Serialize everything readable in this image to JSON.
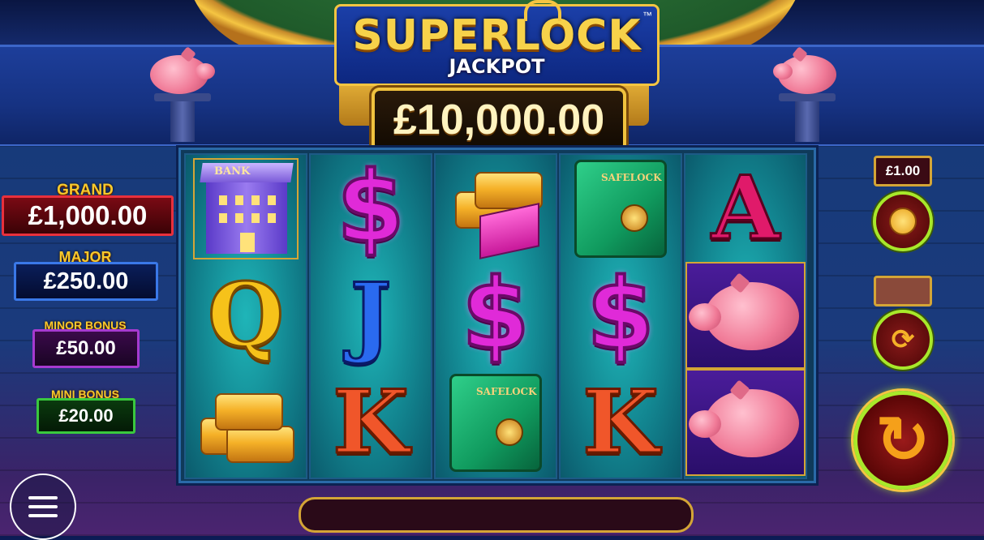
{
  "title": {
    "main": "SUPERLOCK",
    "sub": "JACKPOT",
    "trademark": "™"
  },
  "jackpot": {
    "amount": "£10,000.00"
  },
  "jackpots": [
    {
      "label": "GRAND",
      "value": "£1,000.00",
      "color": "#d81a2a"
    },
    {
      "label": "MAJOR",
      "value": "£250.00",
      "color": "#1a4fc8"
    },
    {
      "label": "MINOR BONUS",
      "value": "£50.00",
      "color": "#8a1fa8"
    },
    {
      "label": "MINI BONUS",
      "value": "£20.00",
      "color": "#1f9a2a"
    }
  ],
  "reels": [
    [
      "bank-symbol",
      "queen-symbol",
      "gold-bars-symbol"
    ],
    [
      "dollar-symbol",
      "jack-symbol",
      "king-symbol"
    ],
    [
      "gold-bars-symbol",
      "dollar-symbol",
      "safe-symbol"
    ],
    [
      "safe-symbol",
      "dollar-symbol",
      "king-symbol"
    ],
    [
      "ace-symbol",
      "piggy-bank-symbol",
      "piggy-bank-symbol"
    ]
  ],
  "symbols": {
    "queen": "Q",
    "jack": "J",
    "king": "K",
    "ace": "A",
    "dollar": "$",
    "bank": "BANK",
    "safe": "SAFELOCK"
  },
  "controls": {
    "stake": "£1.00",
    "stake_icon": "coin-stack-icon",
    "autoplay_icon": "autoplay-icon",
    "spin_icon": "spin-icon",
    "menu_icon": "hamburger-menu-icon"
  },
  "message_bar": "",
  "colors": {
    "gold": "#f5c542",
    "reel_teal": "#12848f",
    "dollar_magenta": "#e02ad8",
    "spin_green": "#a8e82a"
  }
}
